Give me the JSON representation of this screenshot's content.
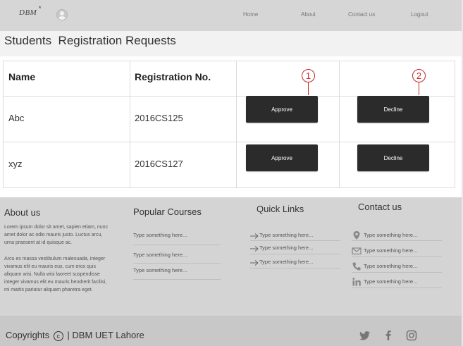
{
  "header": {
    "logo_text": "DBM",
    "logo_star": "*",
    "nav": [
      "Home",
      "About",
      "Contact us",
      "Logout"
    ]
  },
  "page_title": "Students  Registration Requests",
  "table": {
    "headers": [
      "Name",
      "Registration No."
    ],
    "rows": [
      {
        "name": "Abc",
        "reg": "2016CS125",
        "approve": "Approve",
        "decline": "Decline"
      },
      {
        "name": "xyz",
        "reg": "2016CS127",
        "approve": "Approve",
        "decline": "Decline"
      }
    ],
    "markers": [
      "1",
      "2"
    ]
  },
  "footer": {
    "about": {
      "heading": "About us",
      "para1": "Lorem ipsum dolor sit amet, sapien etiam, nunc amet dolor ac odio mauris justo. Luctus arcu, urna praesent at id quisque ac.",
      "para2": "Arcu es massa vestibulum malesuada, integer vivamus elit eu mauris eus, cum eros quis aliquam wisi. Nulla wisi laoreet suspendisse integer vivamus elit eu mauris hendrerit facilisi, mi mattis pariatur aliquam pharetra eget."
    },
    "popular_courses": {
      "heading": "Popular Courses",
      "items": [
        "Type something here...",
        "Type something here...",
        "Type something here..."
      ]
    },
    "quick_links": {
      "heading": "Quick Links",
      "items": [
        "Type something here...",
        "Type something here...",
        "Type something here..."
      ]
    },
    "contact": {
      "heading": "Contact us",
      "items": [
        {
          "icon": "location-icon",
          "text": "Type something here..."
        },
        {
          "icon": "mail-icon",
          "text": "Type something here..."
        },
        {
          "icon": "phone-icon",
          "text": "Type something here..."
        },
        {
          "icon": "linkedin-icon",
          "text": "Type something here..."
        }
      ]
    }
  },
  "bottom": {
    "copyright_pre": "Copyrights",
    "copyright_symbol": "c",
    "copyright_post": "| DBM UET Lahore",
    "social": [
      "twitter-icon",
      "facebook-icon",
      "instagram-icon"
    ]
  },
  "colors": {
    "topbar": "#d6d6d6",
    "footer": "#d4d4d4",
    "bottombar": "#c8c8c8",
    "button": "#2b2b2b",
    "marker": "#c1272d"
  }
}
